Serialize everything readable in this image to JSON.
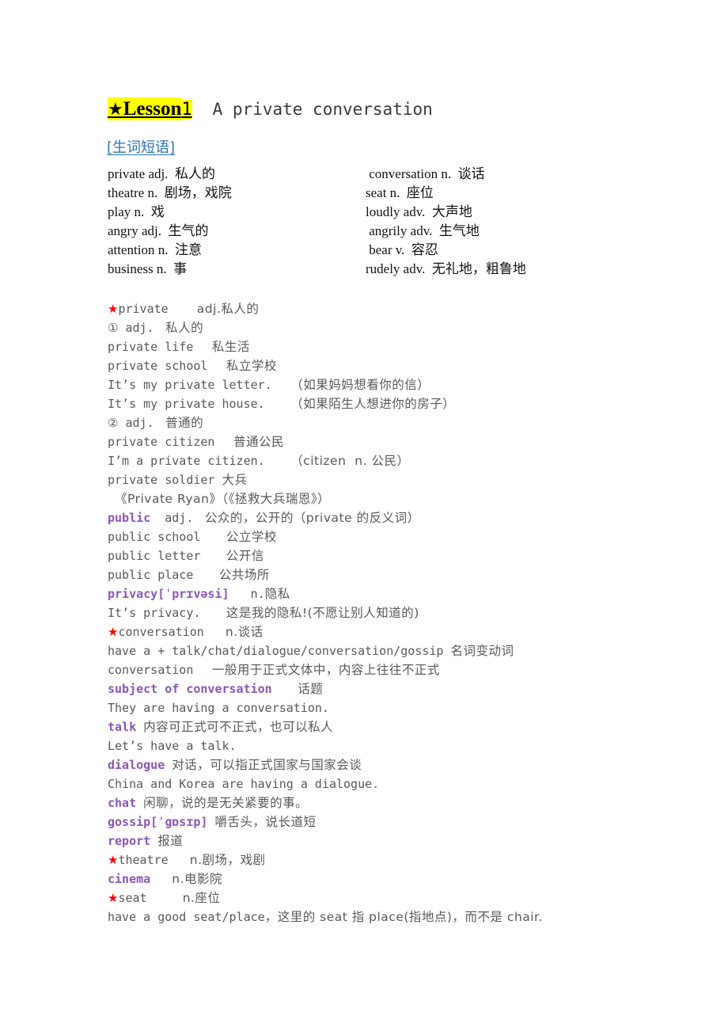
{
  "title": {
    "star_icon": "★",
    "lesson_label": "Lesson",
    "lesson_number": "1",
    "lesson_title": "A private conversation"
  },
  "section_heading": "[生词短语]",
  "vocabulary": {
    "rows": [
      {
        "left": "private adj.  私人的",
        "right": " conversation n.  谈话"
      },
      {
        "left": "theatre n.  剧场，戏院",
        "right": "seat n.  座位"
      },
      {
        "left": "play n.  戏",
        "right": "loudly adv.  大声地"
      },
      {
        "left": "angry adj.  生气的",
        "right": " angrily adv.  生气地"
      },
      {
        "left": "attention n.  注意",
        "right": " bear v.  容忍"
      },
      {
        "left": "business n.  事",
        "right": "rudely adv.  无礼地，粗鲁地"
      }
    ]
  },
  "notes": {
    "lines": [
      {
        "star": true,
        "en": "private    ",
        "cjk": "adj.私人的"
      },
      {
        "circle": "①",
        "en": " adj. ",
        "cjk": " 私人的"
      },
      {
        "en": "private life  ",
        "cjk": " 私生活"
      },
      {
        "en": "private school  ",
        "cjk": " 私立学校"
      },
      {
        "en": "It’s my private letter.  ",
        "cjk": " （如果妈妈想看你的信）"
      },
      {
        "en": "It’s my private house.   ",
        "cjk": " （如果陌生人想进你的房子）"
      },
      {
        "circle": "②",
        "en": " adj. ",
        "cjk": " 普通的"
      },
      {
        "en": "private citizen  ",
        "cjk": " 普通公民"
      },
      {
        "en": "I’m a private citizen.   ",
        "cjk": " （citizen  n. 公民）"
      },
      {
        "en": "private soldier ",
        "cjk": "大兵"
      },
      {
        "en": " ",
        "cjk": "《Private Ryan》（《拯救大兵瑞恩》）"
      },
      {
        "kw": "public",
        "en": "  adj. ",
        "cjk": " 公众的，公开的（private 的反义词）"
      },
      {
        "en": "public school   ",
        "cjk": " 公立学校"
      },
      {
        "en": "public letter   ",
        "cjk": " 公开信"
      },
      {
        "en": "public place   ",
        "cjk": " 公共场所"
      },
      {
        "kw": "privacy[ˈprɪvəsi]",
        "en": "   n.",
        "cjk": "隐私"
      },
      {
        "en": "It’s privacy.   ",
        "cjk": " 这是我的隐私!(不愿让别人知道的)"
      },
      {
        "star": true,
        "en": "conversation   ",
        "cjk": "n.谈话"
      },
      {
        "en": "have a + talk/chat/dialogue/conversation/gossip ",
        "cjk": "名词变动词"
      },
      {
        "en": "conversation  ",
        "cjk": " 一般用于正式文体中，内容上往往不正式"
      },
      {
        "kw": "subject of conversation",
        "en": "   ",
        "cjk": " 话题"
      },
      {
        "en": "They are having a conversation.",
        "cjk": ""
      },
      {
        "kw": "talk",
        "en": " ",
        "cjk": "内容可正式可不正式，也可以私人"
      },
      {
        "en": "Let’s have a talk.",
        "cjk": ""
      },
      {
        "kw": "dialogue",
        "en": " ",
        "cjk": "对话，可以指正式国家与国家会谈"
      },
      {
        "en": "China and Korea are having a dialogue.",
        "cjk": ""
      },
      {
        "kw": "chat",
        "en": " ",
        "cjk": "闲聊，说的是无关紧要的事。"
      },
      {
        "kw": "gossip[ˈɡɒsɪp]",
        "en": " ",
        "cjk": "嚼舌头，说长道短"
      },
      {
        "kw": "report",
        "en": " ",
        "cjk": "报道"
      },
      {
        "star": true,
        "en": "theatre   ",
        "cjk": "n.剧场，戏剧"
      },
      {
        "kw": "cinema",
        "en": "   ",
        "cjk": "n.电影院"
      },
      {
        "star": true,
        "en": "seat     ",
        "cjk": "n.座位"
      },
      {
        "en": "have a good seat/place",
        "cjk": "，这里的 seat 指 place(指地点)，而不是 chair."
      }
    ]
  },
  "colors": {
    "highlight": "#FFFF00",
    "heading_blue": "#2E74B5",
    "keyword_purple": "#8E55B8",
    "star_red": "#FF0000",
    "body_gray": "#595959"
  }
}
